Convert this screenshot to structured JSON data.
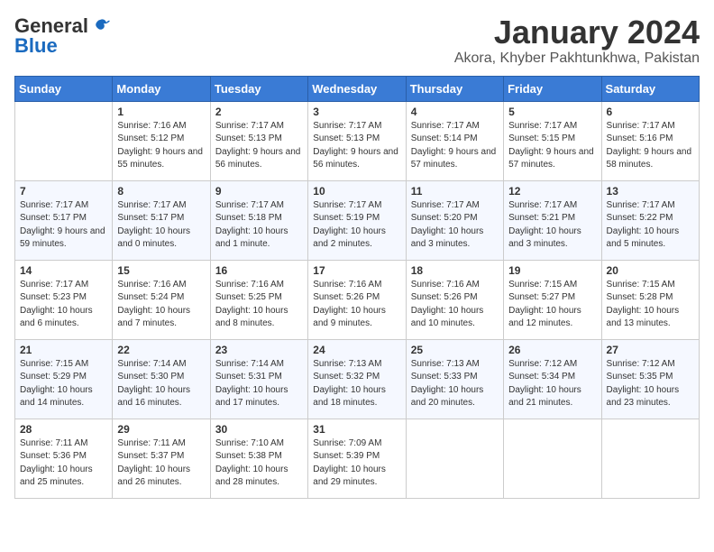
{
  "header": {
    "logo_general": "General",
    "logo_blue": "Blue",
    "month_title": "January 2024",
    "location": "Akora, Khyber Pakhtunkhwa, Pakistan"
  },
  "days_of_week": [
    "Sunday",
    "Monday",
    "Tuesday",
    "Wednesday",
    "Thursday",
    "Friday",
    "Saturday"
  ],
  "weeks": [
    {
      "cells": [
        {
          "day": null,
          "info": null
        },
        {
          "day": "1",
          "sunrise": "7:16 AM",
          "sunset": "5:12 PM",
          "daylight": "9 hours and 55 minutes."
        },
        {
          "day": "2",
          "sunrise": "7:17 AM",
          "sunset": "5:13 PM",
          "daylight": "9 hours and 56 minutes."
        },
        {
          "day": "3",
          "sunrise": "7:17 AM",
          "sunset": "5:13 PM",
          "daylight": "9 hours and 56 minutes."
        },
        {
          "day": "4",
          "sunrise": "7:17 AM",
          "sunset": "5:14 PM",
          "daylight": "9 hours and 57 minutes."
        },
        {
          "day": "5",
          "sunrise": "7:17 AM",
          "sunset": "5:15 PM",
          "daylight": "9 hours and 57 minutes."
        },
        {
          "day": "6",
          "sunrise": "7:17 AM",
          "sunset": "5:16 PM",
          "daylight": "9 hours and 58 minutes."
        }
      ]
    },
    {
      "cells": [
        {
          "day": "7",
          "sunrise": "7:17 AM",
          "sunset": "5:17 PM",
          "daylight": "9 hours and 59 minutes."
        },
        {
          "day": "8",
          "sunrise": "7:17 AM",
          "sunset": "5:17 PM",
          "daylight": "10 hours and 0 minutes."
        },
        {
          "day": "9",
          "sunrise": "7:17 AM",
          "sunset": "5:18 PM",
          "daylight": "10 hours and 1 minute."
        },
        {
          "day": "10",
          "sunrise": "7:17 AM",
          "sunset": "5:19 PM",
          "daylight": "10 hours and 2 minutes."
        },
        {
          "day": "11",
          "sunrise": "7:17 AM",
          "sunset": "5:20 PM",
          "daylight": "10 hours and 3 minutes."
        },
        {
          "day": "12",
          "sunrise": "7:17 AM",
          "sunset": "5:21 PM",
          "daylight": "10 hours and 3 minutes."
        },
        {
          "day": "13",
          "sunrise": "7:17 AM",
          "sunset": "5:22 PM",
          "daylight": "10 hours and 5 minutes."
        }
      ]
    },
    {
      "cells": [
        {
          "day": "14",
          "sunrise": "7:17 AM",
          "sunset": "5:23 PM",
          "daylight": "10 hours and 6 minutes."
        },
        {
          "day": "15",
          "sunrise": "7:16 AM",
          "sunset": "5:24 PM",
          "daylight": "10 hours and 7 minutes."
        },
        {
          "day": "16",
          "sunrise": "7:16 AM",
          "sunset": "5:25 PM",
          "daylight": "10 hours and 8 minutes."
        },
        {
          "day": "17",
          "sunrise": "7:16 AM",
          "sunset": "5:26 PM",
          "daylight": "10 hours and 9 minutes."
        },
        {
          "day": "18",
          "sunrise": "7:16 AM",
          "sunset": "5:26 PM",
          "daylight": "10 hours and 10 minutes."
        },
        {
          "day": "19",
          "sunrise": "7:15 AM",
          "sunset": "5:27 PM",
          "daylight": "10 hours and 12 minutes."
        },
        {
          "day": "20",
          "sunrise": "7:15 AM",
          "sunset": "5:28 PM",
          "daylight": "10 hours and 13 minutes."
        }
      ]
    },
    {
      "cells": [
        {
          "day": "21",
          "sunrise": "7:15 AM",
          "sunset": "5:29 PM",
          "daylight": "10 hours and 14 minutes."
        },
        {
          "day": "22",
          "sunrise": "7:14 AM",
          "sunset": "5:30 PM",
          "daylight": "10 hours and 16 minutes."
        },
        {
          "day": "23",
          "sunrise": "7:14 AM",
          "sunset": "5:31 PM",
          "daylight": "10 hours and 17 minutes."
        },
        {
          "day": "24",
          "sunrise": "7:13 AM",
          "sunset": "5:32 PM",
          "daylight": "10 hours and 18 minutes."
        },
        {
          "day": "25",
          "sunrise": "7:13 AM",
          "sunset": "5:33 PM",
          "daylight": "10 hours and 20 minutes."
        },
        {
          "day": "26",
          "sunrise": "7:12 AM",
          "sunset": "5:34 PM",
          "daylight": "10 hours and 21 minutes."
        },
        {
          "day": "27",
          "sunrise": "7:12 AM",
          "sunset": "5:35 PM",
          "daylight": "10 hours and 23 minutes."
        }
      ]
    },
    {
      "cells": [
        {
          "day": "28",
          "sunrise": "7:11 AM",
          "sunset": "5:36 PM",
          "daylight": "10 hours and 25 minutes."
        },
        {
          "day": "29",
          "sunrise": "7:11 AM",
          "sunset": "5:37 PM",
          "daylight": "10 hours and 26 minutes."
        },
        {
          "day": "30",
          "sunrise": "7:10 AM",
          "sunset": "5:38 PM",
          "daylight": "10 hours and 28 minutes."
        },
        {
          "day": "31",
          "sunrise": "7:09 AM",
          "sunset": "5:39 PM",
          "daylight": "10 hours and 29 minutes."
        },
        {
          "day": null,
          "info": null
        },
        {
          "day": null,
          "info": null
        },
        {
          "day": null,
          "info": null
        }
      ]
    }
  ],
  "labels": {
    "sunrise": "Sunrise:",
    "sunset": "Sunset:",
    "daylight": "Daylight:"
  }
}
